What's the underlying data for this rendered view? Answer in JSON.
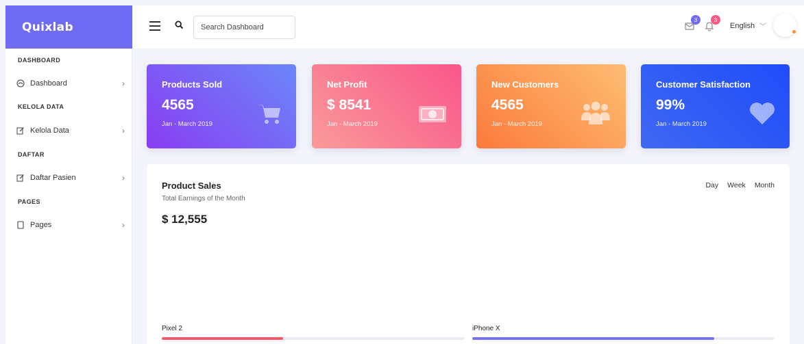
{
  "brand": {
    "name": "Quixlab",
    "color": "#6f6bf2"
  },
  "sidebar": {
    "sections": [
      {
        "heading": "DASHBOARD",
        "item": {
          "label": "Dashboard",
          "icon": "gauge-icon"
        }
      },
      {
        "heading": "KELOLA DATA",
        "item": {
          "label": "Kelola Data",
          "icon": "edit-icon"
        }
      },
      {
        "heading": "DAFTAR",
        "item": {
          "label": "Daftar Pasien",
          "icon": "edit-icon"
        }
      },
      {
        "heading": "PAGES",
        "item": {
          "label": "Pages",
          "icon": "page-icon"
        }
      }
    ]
  },
  "header": {
    "search": {
      "placeholder": "Search Dashboard"
    },
    "mail": {
      "badge": "3",
      "badge_color": "#6f6bf2"
    },
    "notifications": {
      "badge": "3",
      "badge_color": "#f75a82"
    },
    "language": "English"
  },
  "cards": [
    {
      "title": "Products Sold",
      "value": "4565",
      "period": "Jan - March 2019",
      "icon": "cart-icon"
    },
    {
      "title": "Net Profit",
      "value": "$ 8541",
      "period": "Jan - March 2019",
      "icon": "money-icon"
    },
    {
      "title": "New Customers",
      "value": "4565",
      "period": "Jan - March 2019",
      "icon": "users-icon"
    },
    {
      "title": "Customer Satisfaction",
      "value": "99%",
      "period": "Jan - March 2019",
      "icon": "heart-icon"
    }
  ],
  "sales": {
    "title": "Product Sales",
    "subtitle": "Total Earnings of the Month",
    "total": "$ 12,555",
    "ranges": [
      "Day",
      "Week",
      "Month"
    ],
    "products": [
      {
        "name": "Pixel 2",
        "progress": 0.4,
        "color": "#f7596b"
      },
      {
        "name": "iPhone X",
        "progress": 0.8,
        "color": "#7571f9"
      }
    ]
  }
}
